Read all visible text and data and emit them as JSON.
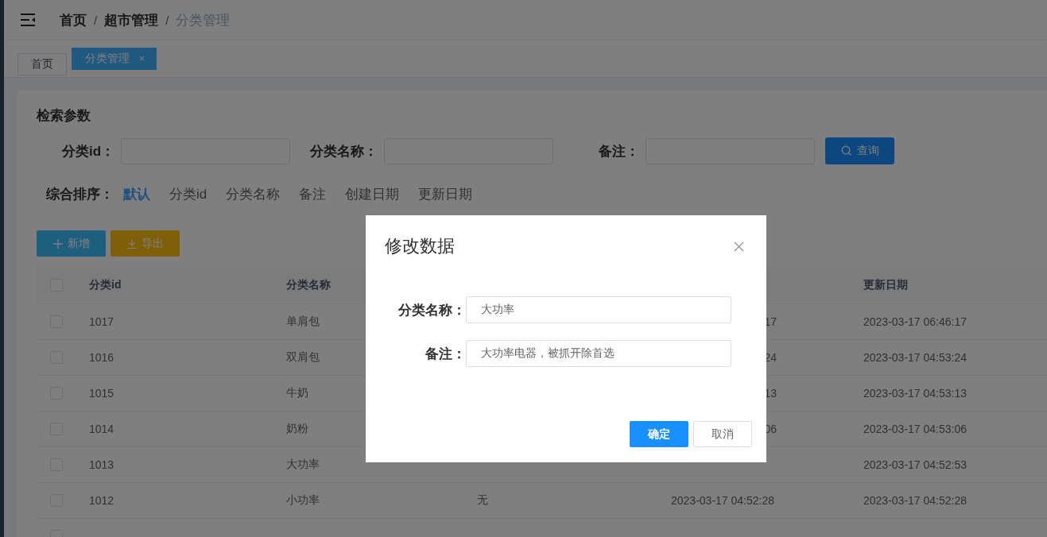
{
  "breadcrumb_separator": "/",
  "breadcrumb": [
    {
      "label": "首页",
      "current": false
    },
    {
      "label": "超市管理",
      "current": false
    },
    {
      "label": "分类管理",
      "current": true
    }
  ],
  "tabs": [
    {
      "label": "首页",
      "selected": false
    },
    {
      "label": "分类管理",
      "selected": true,
      "close": "×"
    }
  ],
  "search": {
    "title": "检索参数",
    "fields": [
      {
        "label": "分类id："
      },
      {
        "label": "分类名称："
      },
      {
        "label": "备注："
      }
    ],
    "button": "查询"
  },
  "sort": {
    "label": "综合排序：",
    "options": [
      {
        "label": "默认",
        "selected": true
      },
      {
        "label": "分类id",
        "selected": false
      },
      {
        "label": "分类名称",
        "selected": false
      },
      {
        "label": "备注",
        "selected": false
      },
      {
        "label": "创建日期",
        "selected": false
      },
      {
        "label": "更新日期",
        "selected": false
      }
    ]
  },
  "actions": [
    {
      "label": "新增",
      "kind": "add"
    },
    {
      "label": "导出",
      "kind": "export"
    }
  ],
  "table": {
    "all_checked": false,
    "columns": [
      "分类id",
      "分类名称",
      null,
      null,
      "更新日期"
    ],
    "rows": [
      {
        "checked": false,
        "covered": true,
        "cells": [
          "1017",
          "单肩包",
          null,
          "17",
          "2023-03-17 06:46:17"
        ]
      },
      {
        "checked": false,
        "covered": true,
        "cells": [
          "1016",
          "双肩包",
          null,
          "24",
          "2023-03-17 04:53:24"
        ]
      },
      {
        "checked": false,
        "covered": true,
        "cells": [
          "1015",
          "牛奶",
          null,
          "13",
          "2023-03-17 04:53:13"
        ]
      },
      {
        "checked": false,
        "covered": true,
        "cells": [
          "1014",
          "奶粉",
          null,
          "06",
          "2023-03-17 04:53:06"
        ]
      },
      {
        "checked": false,
        "cells": [
          "1013",
          "大功率",
          null,
          null,
          "2023-03-17 04:52:53"
        ]
      },
      {
        "checked": false,
        "cells": [
          "1012",
          "小功率",
          "无",
          "2023-03-17 04:52:28",
          "2023-03-17 04:52:28"
        ]
      },
      {
        "checked": false,
        "cells": [
          null,
          null,
          null,
          null,
          null
        ]
      }
    ]
  },
  "dialog": {
    "title": "修改数据",
    "fields": [
      {
        "label": "分类名称：",
        "value": "大功率"
      },
      {
        "label": "备注：",
        "value": "大功率电器，被抓开除首选"
      }
    ],
    "buttons": [
      {
        "label": "确定",
        "kind": "primary"
      },
      {
        "label": "取消",
        "kind": "default"
      }
    ]
  }
}
